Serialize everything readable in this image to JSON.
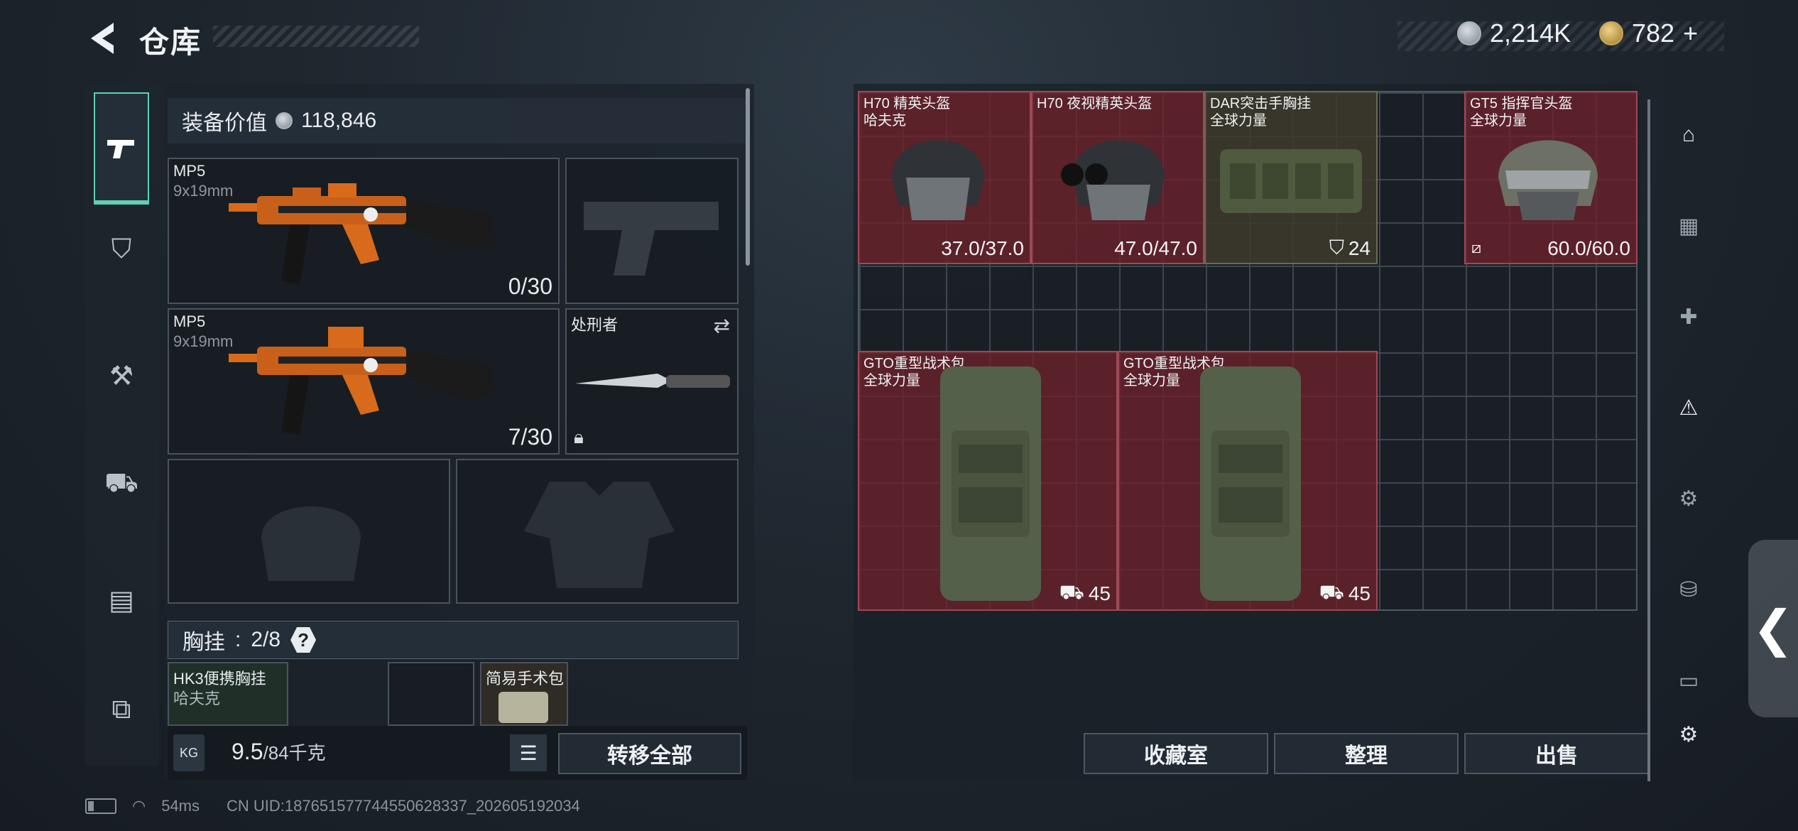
{
  "header": {
    "title": "仓库"
  },
  "currency": {
    "silver": "2,214K",
    "gold": "782",
    "gold_add": "+"
  },
  "loadout": {
    "value_label": "装备价值",
    "value": "118,846",
    "weapons": [
      {
        "name": "MP5",
        "ammo_type": "9x19mm",
        "ammo": "0/30"
      },
      {
        "name": "MP5",
        "ammo_type": "9x19mm",
        "ammo": "7/30"
      }
    ],
    "melee": {
      "name": "处刑者"
    },
    "vest_label": "胸挂",
    "vest_count": "2/8",
    "help": "?",
    "vest_items": [
      {
        "name": "HK3便携胸挂",
        "sub": "哈夫克"
      },
      {
        "name": "简易手术包"
      }
    ],
    "weight": "9.5",
    "weight_cap": "/84千克",
    "weight_icon": "KG",
    "transfer_all": "转移全部"
  },
  "stash": {
    "items": [
      {
        "name": "H70 精英头盔",
        "sub": "哈夫克",
        "value": "37.0/37.0"
      },
      {
        "name": "H70 夜视精英头盔",
        "sub": "",
        "value": "47.0/47.0"
      },
      {
        "name": "DAR突击手胸挂",
        "sub": "全球力量",
        "value": "24"
      },
      {
        "name": "GT5 指挥官头盔",
        "sub": "全球力量",
        "value": "60.0/60.0"
      },
      {
        "name": "GTO重型战术包",
        "sub": "全球力量",
        "value": "45"
      },
      {
        "name": "GTO重型战术包",
        "sub": "全球力量",
        "value": "45"
      }
    ],
    "buttons": {
      "collection": "收藏室",
      "sort": "整理",
      "sell": "出售"
    }
  },
  "status": {
    "ping": "54ms",
    "uid": "CN UID:18765157774455062833​7_202605192034"
  }
}
